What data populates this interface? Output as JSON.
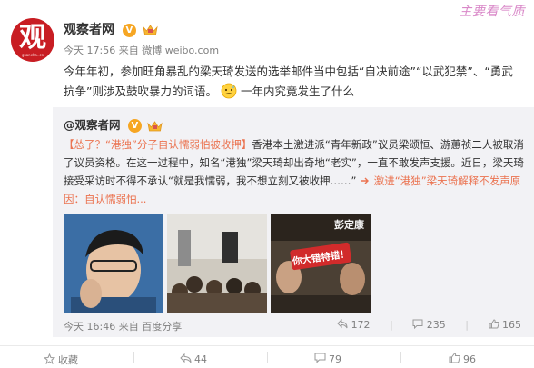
{
  "watermark": "主要看气质",
  "post": {
    "author": "观察者网",
    "avatar_text": "观",
    "avatar_url": "guancha.cn",
    "verified": "V",
    "time": "今天 17:56",
    "source_prefix": "来自",
    "source": "微博 weibo.com",
    "text_part1": "今年年初，参加旺角暴乱的梁天琦发送的选举邮件当中包括“自决前途”“以武犯禁”、“勇武抗争”则涉及鼓吹暴力的词语。",
    "text_part2": "一年内究竟发生了什么"
  },
  "repost": {
    "author": "@观察者网",
    "text_lead": "【怂了？“港独”分子自认懦弱怕被收押】",
    "text_body": "香港本土激进派“青年新政”议员梁颂恒、游蕙祯二人被取消了议员资格。在这一过程中，知名“港独”梁天琦却出奇地“老实”，一直不敢发声支援。近日，梁天琦接受采访时不得不承认“就是我懦弱，我不想立刻又被收押……”",
    "link_text": "激进“港独”梁天琦解释不发声原因：自认懦弱怕...",
    "photo3_overlay_top": "彭定康",
    "photo3_overlay_sign": "你大错特错！",
    "time": "今天 16:46",
    "source_prefix": "来自",
    "source": "百度分享",
    "stats": {
      "reposts": "172",
      "comments": "235",
      "likes": "165"
    }
  },
  "footer": {
    "favorite": "收藏",
    "repost_count": "44",
    "comment_count": "79",
    "like_count": "96"
  }
}
